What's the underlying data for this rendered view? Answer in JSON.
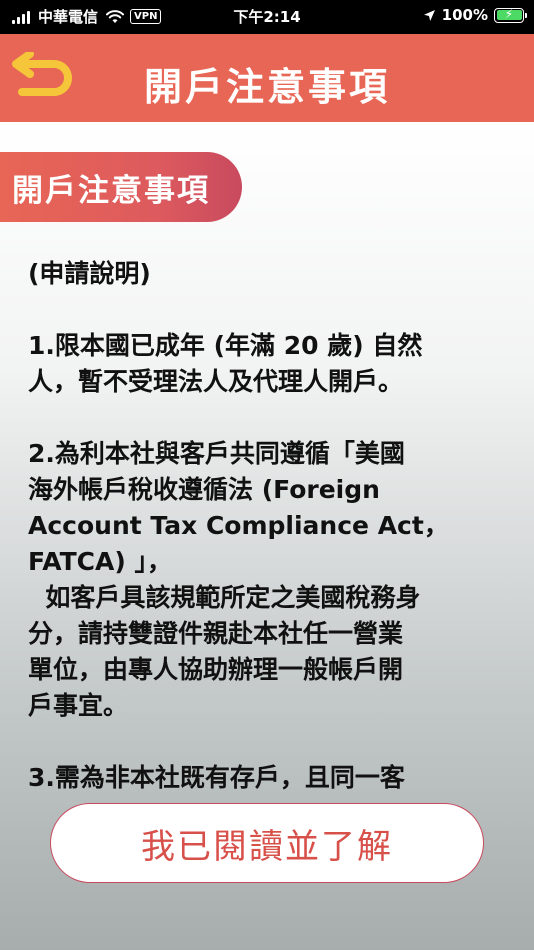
{
  "status_bar": {
    "carrier": "中華電信",
    "vpn": "VPN",
    "time": "下午2:14",
    "battery": "100%"
  },
  "nav": {
    "title": "開戶注意事項",
    "back_icon": "back-arrow-icon"
  },
  "section": {
    "tab_label": "開戶注意事項"
  },
  "notice": {
    "lines": [
      "(申請說明)",
      "",
      "1.限本國已成年 (年滿 20 歲) 自然",
      "人，暫不受理法人及代理人開戶。",
      "",
      "2.為利本社與客戶共同遵循「美國",
      "海外帳戶稅收遵循法 (Foreign",
      "Account Tax Compliance Act，",
      "FATCA) 」，",
      "  如客戶具該規範所定之美國稅務身",
      "分，請持雙證件親赴本社任一營業",
      "單位，由專人協助辦理一般帳戶開",
      "戶事宜。",
      "",
      "3.需為非本社既有存戶，且同一客"
    ]
  },
  "confirm_button": {
    "label": "我已閱讀並了解"
  },
  "colors": {
    "accent": "#e86655",
    "button_text": "#d8504a",
    "back_icon": "#f5c63a"
  }
}
